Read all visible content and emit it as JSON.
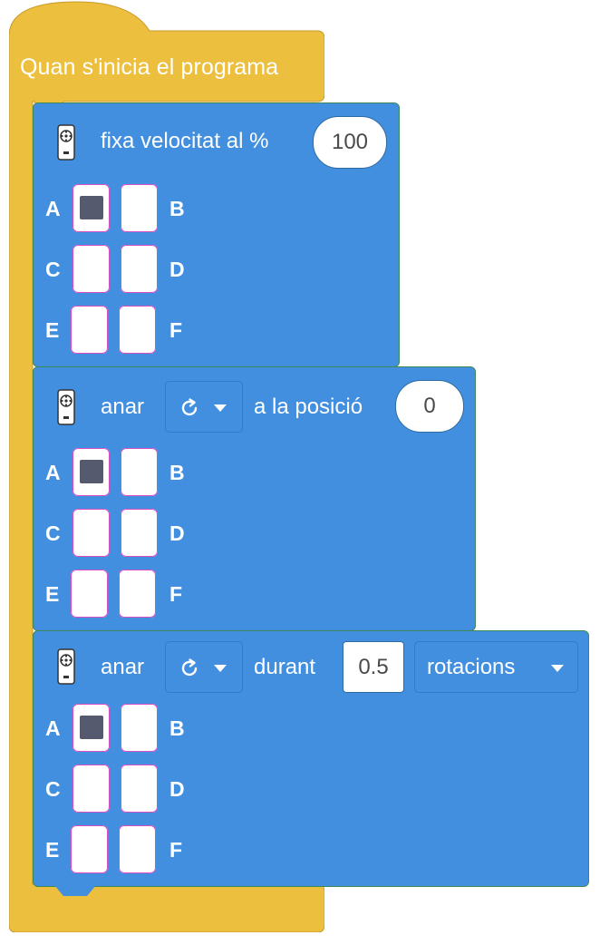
{
  "colors": {
    "event": "#ecbf3f",
    "motor": "#428fe0",
    "selected_port": "#555a6e"
  },
  "hat": {
    "title": "Quan s'inicia el programa"
  },
  "blocks": [
    {
      "label": "fixa velocitat al %",
      "value": "100",
      "ports": [
        "A",
        "B",
        "C",
        "D",
        "E",
        "F"
      ],
      "selected": [
        "A"
      ]
    },
    {
      "label_before": "anar",
      "direction_icon": "rotate-clockwise-icon",
      "label_after": "a la posició",
      "value": "0",
      "ports": [
        "A",
        "B",
        "C",
        "D",
        "E",
        "F"
      ],
      "selected": [
        "A"
      ]
    },
    {
      "label_before": "anar",
      "direction_icon": "rotate-clockwise-icon",
      "label_after": "durant",
      "value": "0.5",
      "unit": "rotacions",
      "ports": [
        "A",
        "B",
        "C",
        "D",
        "E",
        "F"
      ],
      "selected": [
        "A"
      ]
    }
  ]
}
